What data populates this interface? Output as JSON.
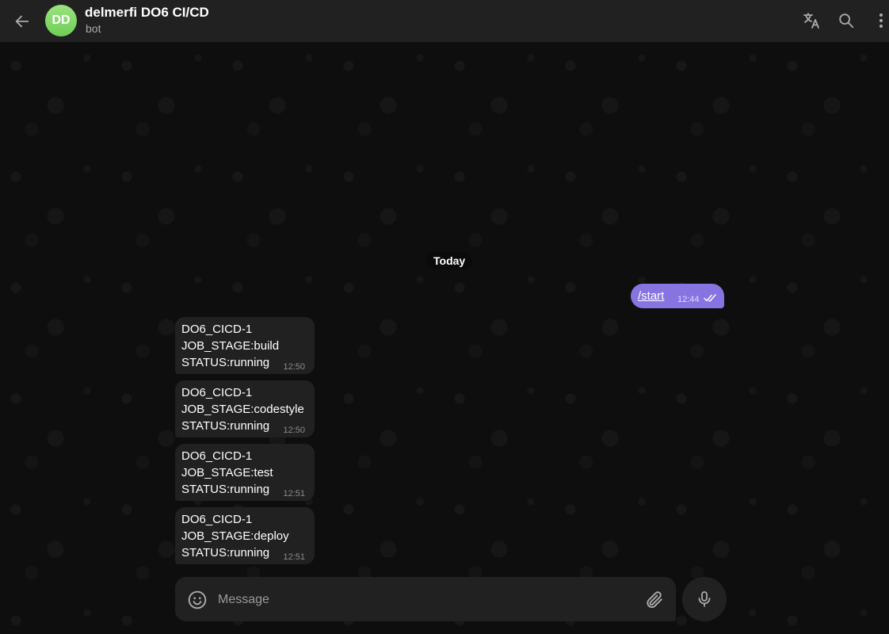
{
  "header": {
    "avatar_initials": "DD",
    "title": "delmerfi DO6 CI/CD",
    "subtitle": "bot",
    "icons": [
      "back-arrow-icon",
      "translate-icon",
      "search-icon",
      "more-vertical-icon"
    ]
  },
  "date_separator": "Today",
  "outgoing": {
    "text": "/start",
    "time": "12:44",
    "status": "read"
  },
  "incoming": [
    {
      "line1": "DO6_CICD-1",
      "line2": "JOB_STAGE:build",
      "line3": "STATUS:running",
      "time": "12:50"
    },
    {
      "line1": "DO6_CICD-1",
      "line2": "JOB_STAGE:codestyle",
      "line3": "STATUS:running",
      "time": "12:50"
    },
    {
      "line1": "DO6_CICD-1",
      "line2": "JOB_STAGE:test",
      "line3": "STATUS:running",
      "time": "12:51"
    },
    {
      "line1": "DO6_CICD-1",
      "line2": "JOB_STAGE:deploy",
      "line3": "STATUS:running",
      "time": "12:51"
    }
  ],
  "composer": {
    "placeholder": "Message",
    "value": ""
  },
  "colors": {
    "accent": "#8774e1",
    "header_bg": "#212121",
    "bubble_bg": "#212121",
    "avatar": "#7ed567"
  }
}
